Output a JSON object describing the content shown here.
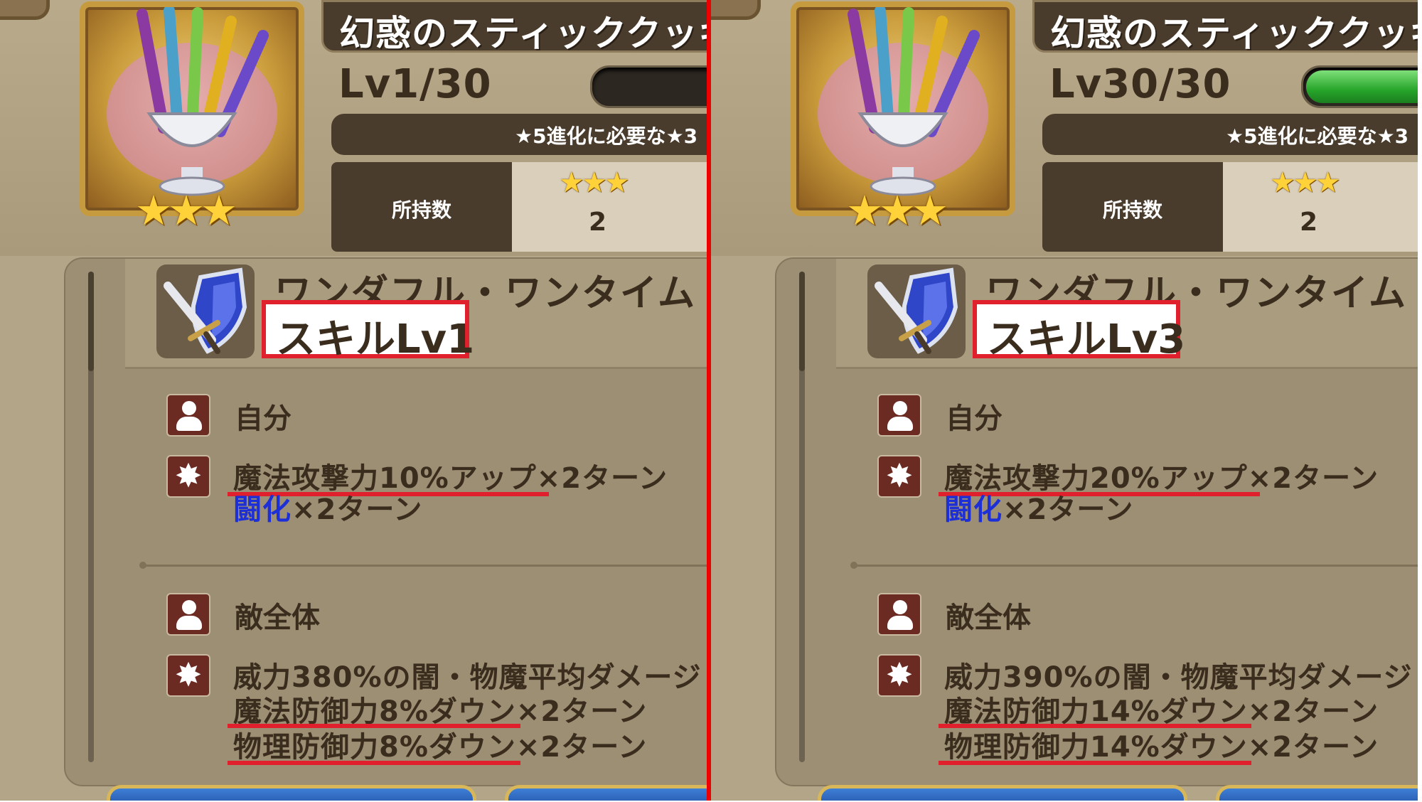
{
  "panels": {
    "left": {
      "item_title": "幻惑のスティッククッキ",
      "level": "Lv1/30",
      "exp_fill": 0,
      "evolve_text": "★5進化に必要な★3",
      "own_label": "所持数",
      "own_stars": "★★★",
      "own_count": "2",
      "item_stars": "★★★",
      "skill_name": "ワンダフル・ワンタイム・",
      "skill_level": "スキルLv1",
      "self_label": "自分",
      "self_eff_1": "魔法攻撃力10%アップ×2ターン",
      "self_eff_2_blue": "闘化",
      "self_eff_2_rest": "×2ターン",
      "enemy_label": "敵全体",
      "enemy_eff_1": "威力380%の闇・物魔平均ダメージ",
      "enemy_eff_2": "魔法防御力8%ダウン×2ターン",
      "enemy_eff_3": "物理防御力8%ダウン×2ターン"
    },
    "right": {
      "item_title": "幻惑のスティッククッキ",
      "level": "Lv30/30",
      "exp_fill": 1,
      "evolve_text": "★5進化に必要な★3",
      "own_label": "所持数",
      "own_stars": "★★★",
      "own_count": "2",
      "item_stars": "★★★",
      "skill_name": "ワンダフル・ワンタイム・",
      "skill_level": "スキルLv3",
      "self_label": "自分",
      "self_eff_1": "魔法攻撃力20%アップ×2ターン",
      "self_eff_2_blue": "闘化",
      "self_eff_2_rest": "×2ターン",
      "enemy_label": "敵全体",
      "enemy_eff_1": "威力390%の闇・物魔平均ダメージ",
      "enemy_eff_2": "魔法防御力14%ダウン×2ターン",
      "enemy_eff_3": "物理防御力14%ダウン×2ターン"
    }
  },
  "icons": {
    "self": "person-icon",
    "effect": "burst-icon",
    "skill": "sword-shield-icon"
  },
  "colors": {
    "highlight": "#e0202c",
    "buff_blue": "#1d2fd6",
    "exp_green": "#27a52a"
  }
}
